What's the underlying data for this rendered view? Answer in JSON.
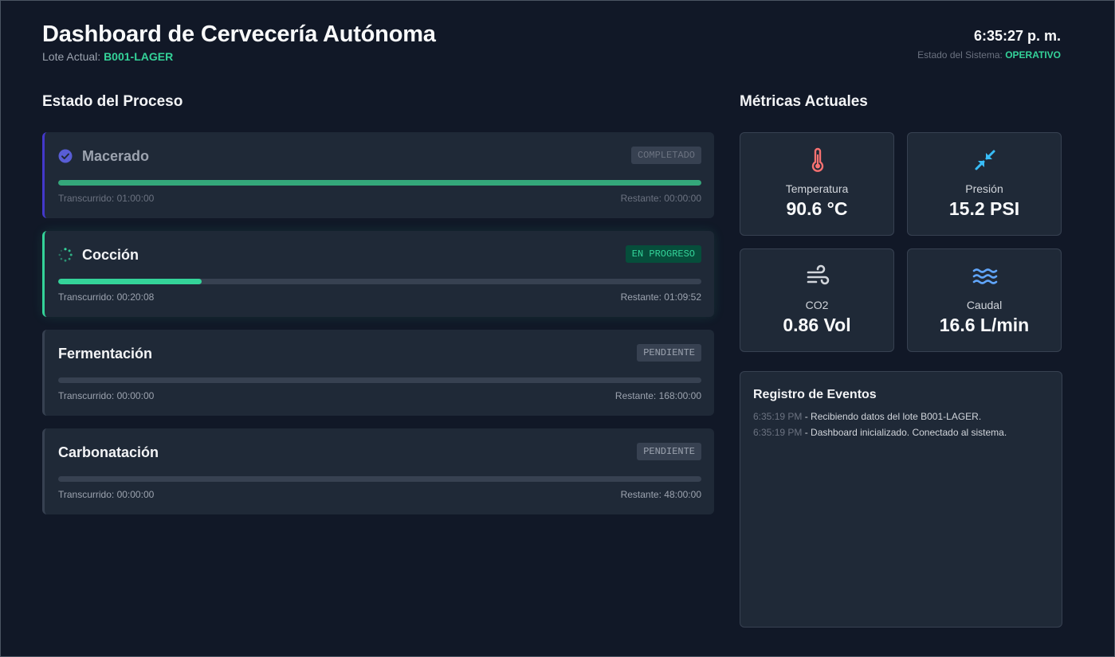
{
  "header": {
    "title": "Dashboard de Cervecería Autónoma",
    "lot_label": "Lote Actual:",
    "lot_id": "B001-LAGER",
    "clock": "6:35:27 p. m.",
    "system_label": "Estado del Sistema:",
    "system_status": "OPERATIVO"
  },
  "process": {
    "title": "Estado del Proceso",
    "stages": [
      {
        "name": "Macerado",
        "status": "COMPLETADO",
        "progress": 1.0,
        "elapsed": "Transcurrido: 01:00:00",
        "remaining": "Restante: 00:00:00",
        "icon": "check-circle-icon"
      },
      {
        "name": "Cocción",
        "status": "EN PROGRESO",
        "progress": 0.223,
        "elapsed": "Transcurrido: 00:20:08",
        "remaining": "Restante: 01:09:52",
        "icon": "spinner-icon"
      },
      {
        "name": "Fermentación",
        "status": "PENDIENTE",
        "progress": 0,
        "elapsed": "Transcurrido: 00:00:00",
        "remaining": "Restante: 168:00:00"
      },
      {
        "name": "Carbonatación",
        "status": "PENDIENTE",
        "progress": 0,
        "elapsed": "Transcurrido: 00:00:00",
        "remaining": "Restante: 48:00:00"
      }
    ]
  },
  "metrics": {
    "title": "Métricas Actuales",
    "items": [
      {
        "label": "Temperatura",
        "value": "90.6 °C",
        "icon": "thermometer-icon",
        "color": "#f87171"
      },
      {
        "label": "Presión",
        "value": "15.2 PSI",
        "icon": "compress-arrows-icon",
        "color": "#38bdf8"
      },
      {
        "label": "CO2",
        "value": "0.86 Vol",
        "icon": "wind-icon",
        "color": "#d1d5db"
      },
      {
        "label": "Caudal",
        "value": "16.6 L/min",
        "icon": "water-waves-icon",
        "color": "#60a5fa"
      }
    ]
  },
  "log": {
    "title": "Registro de Eventos",
    "entries": [
      {
        "time": "6:35:19 PM",
        "message": " - Recibiendo datos del lote B001-LAGER."
      },
      {
        "time": "6:35:19 PM",
        "message": " - Dashboard inicializado. Conectado al sistema."
      }
    ]
  },
  "colors": {
    "background": "#111827",
    "card": "#1f2937",
    "accent_green": "#34d399",
    "accent_indigo": "#4338ca"
  }
}
